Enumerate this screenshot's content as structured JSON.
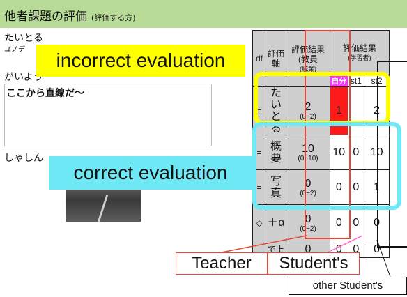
{
  "header": {
    "title": "他者課題の評価",
    "subtitle": "(評価する方)"
  },
  "left": {
    "title_line": "たいとる",
    "small_line": "ユノデ",
    "label_line": "がいよう",
    "comment": "ここから直線だ～",
    "shashin": "しゃしん"
  },
  "callouts": {
    "incorrect": "incorrect evaluation",
    "correct": "correct evaluation",
    "teacher": "Teacher",
    "student": "Student's",
    "other": "other Student's"
  },
  "table": {
    "headers": {
      "df": "df",
      "axis_1": "評価",
      "axis_2": "軸",
      "teacher_1": "評価結果",
      "teacher_2": "(教員",
      "teacher_3": "(統業)",
      "student_1": "評価結果",
      "student_2": "(学習者)",
      "self": "自分",
      "st1": "st1",
      "st2": "st2"
    },
    "rows": [
      {
        "df": "=",
        "axis": "たいとる",
        "teacher": "2",
        "range": "(0~2)",
        "self": "1",
        "st1": "",
        "st2": "2",
        "highlight": true
      },
      {
        "df": "=",
        "axis": "概要",
        "teacher": "10",
        "range": "(0~10)",
        "self": "10",
        "st1": "0",
        "st2": "10",
        "highlight": false
      },
      {
        "df": "=",
        "axis": "写真",
        "teacher": "0",
        "range": "(0~2)",
        "self": "0",
        "st1": "0",
        "st2": "1",
        "highlight": false
      },
      {
        "df": "◇",
        "axis": "＋α",
        "teacher": "0",
        "range": "(0~2)",
        "self": "0",
        "st1": "0",
        "st2": "0",
        "highlight": false
      },
      {
        "df": "",
        "axis": "で上",
        "teacher": "0",
        "range": "",
        "self": "0",
        "st1": "0",
        "st2": "0",
        "highlight": false
      }
    ]
  }
}
